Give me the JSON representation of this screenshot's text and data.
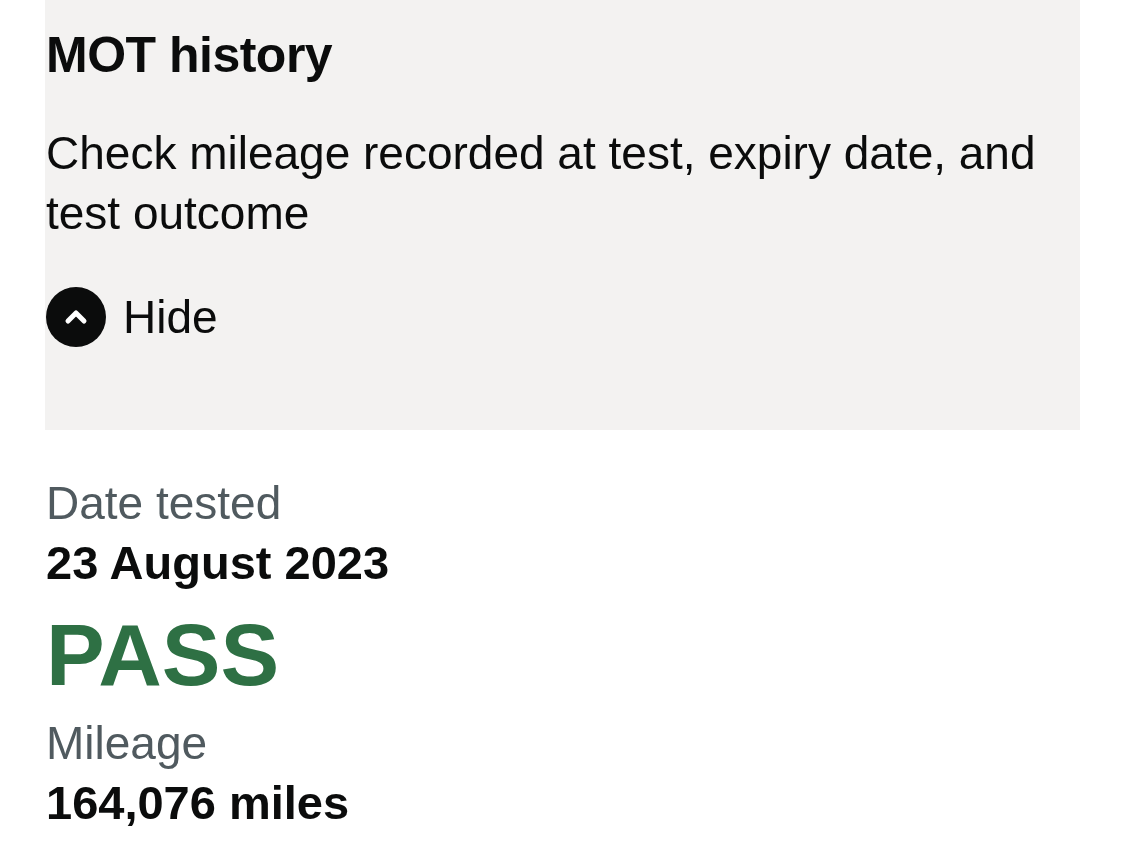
{
  "panel": {
    "title": "MOT history",
    "description": "Check mileage recorded at test, expiry date, and test outcome",
    "toggle": {
      "label": "Hide",
      "expanded": true
    }
  },
  "test": {
    "date_label": "Date tested",
    "date": "23 August 2023",
    "result": {
      "text": "PASS",
      "passed": true
    },
    "mileage_label": "Mileage",
    "mileage": "164,076 miles"
  }
}
